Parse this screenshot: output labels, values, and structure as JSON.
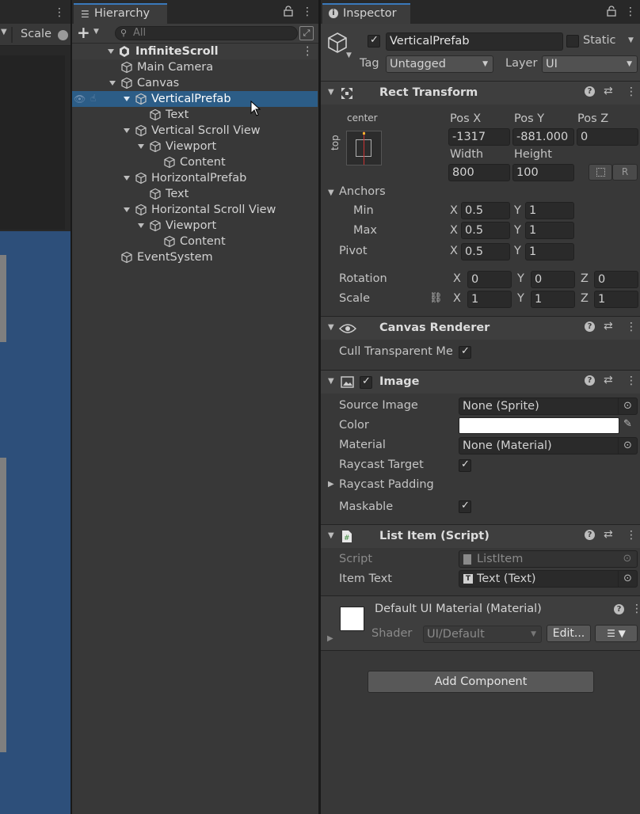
{
  "scene": {
    "scale_label": "Scale"
  },
  "hierarchy": {
    "tab_title": "Hierarchy",
    "add_label": "+",
    "search_placeholder": "All",
    "root": "InfiniteScroll",
    "items": [
      {
        "label": "Main Camera",
        "depth": 1,
        "arrow": "none"
      },
      {
        "label": "Canvas",
        "depth": 1,
        "arrow": "down"
      },
      {
        "label": "VerticalPrefab",
        "depth": 2,
        "arrow": "down",
        "selected": true
      },
      {
        "label": "Text",
        "depth": 3,
        "arrow": "none"
      },
      {
        "label": "Vertical Scroll View",
        "depth": 2,
        "arrow": "down"
      },
      {
        "label": "Viewport",
        "depth": 3,
        "arrow": "down"
      },
      {
        "label": "Content",
        "depth": 4,
        "arrow": "none"
      },
      {
        "label": "HorizontalPrefab",
        "depth": 2,
        "arrow": "down"
      },
      {
        "label": "Text",
        "depth": 3,
        "arrow": "none"
      },
      {
        "label": "Horizontal Scroll View",
        "depth": 2,
        "arrow": "down"
      },
      {
        "label": "Viewport",
        "depth": 3,
        "arrow": "down"
      },
      {
        "label": "Content",
        "depth": 4,
        "arrow": "none"
      },
      {
        "label": "EventSystem",
        "depth": 1,
        "arrow": "none"
      }
    ]
  },
  "inspector": {
    "tab_title": "Inspector",
    "object_name": "VerticalPrefab",
    "static_label": "Static",
    "tag_label": "Tag",
    "tag_value": "Untagged",
    "layer_label": "Layer",
    "layer_value": "UI",
    "rect_transform": {
      "title": "Rect Transform",
      "anchor_h": "center",
      "anchor_v": "top",
      "posx_label": "Pos X",
      "posy_label": "Pos Y",
      "posz_label": "Pos Z",
      "posx": "-1317",
      "posy": "-881.000",
      "posz": "0",
      "width_label": "Width",
      "height_label": "Height",
      "width": "800",
      "height": "100",
      "r_label": "R",
      "anchors_label": "Anchors",
      "min_label": "Min",
      "max_label": "Max",
      "min_x": "0.5",
      "min_y": "1",
      "max_x": "0.5",
      "max_y": "1",
      "pivot_label": "Pivot",
      "pivot_x": "0.5",
      "pivot_y": "1",
      "rotation_label": "Rotation",
      "rot_x": "0",
      "rot_y": "0",
      "rot_z": "0",
      "scale_label": "Scale",
      "scale_x": "1",
      "scale_y": "1",
      "scale_z": "1",
      "x": "X",
      "y": "Y",
      "z": "Z"
    },
    "canvas_renderer": {
      "title": "Canvas Renderer",
      "cull_label": "Cull Transparent Mesh",
      "cull_checked": true
    },
    "image": {
      "title": "Image",
      "source_label": "Source Image",
      "source_value": "None (Sprite)",
      "color_label": "Color",
      "color_value": "#ffffff",
      "material_label": "Material",
      "material_value": "None (Material)",
      "raycast_target_label": "Raycast Target",
      "raycast_padding_label": "Raycast Padding",
      "maskable_label": "Maskable"
    },
    "list_item": {
      "title": "List Item (Script)",
      "script_label": "Script",
      "script_value": "ListItem",
      "item_text_label": "Item Text",
      "item_text_value": "Text (Text)"
    },
    "material": {
      "title": "Default UI Material (Material)",
      "shader_label": "Shader",
      "shader_value": "UI/Default",
      "edit_label": "Edit..."
    },
    "add_component_label": "Add Component"
  },
  "colors": {
    "selection": "#2c5d87",
    "accent": "#3a79bb",
    "scene_blue": "#2d4f7a"
  }
}
